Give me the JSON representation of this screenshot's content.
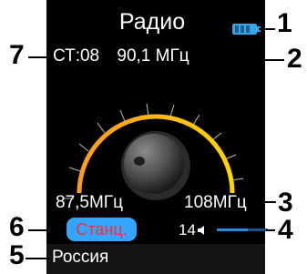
{
  "header": {
    "title": "Радио"
  },
  "status": {
    "station_text": "СТ:08",
    "frequency_text": "90,1 МГц",
    "range_min": "87,5МГц",
    "range_max": "108МГц",
    "volume_value": "14",
    "volume_level": 0.6
  },
  "controls": {
    "station_button_label": "Станц."
  },
  "footer": {
    "country": "Россия"
  },
  "callouts": [
    "1",
    "2",
    "3",
    "4",
    "5",
    "6",
    "7"
  ],
  "icons": {
    "battery": "battery-icon",
    "speaker": "speaker-icon",
    "tuning_knob": "tuning-knob-icon"
  },
  "colors": {
    "accent_blue": "#33a7ff",
    "station_label_red": "#ff2a2a",
    "dial_arc_gradient_start": "#ff9a1c",
    "dial_arc_gradient_end": "#ffd600"
  }
}
